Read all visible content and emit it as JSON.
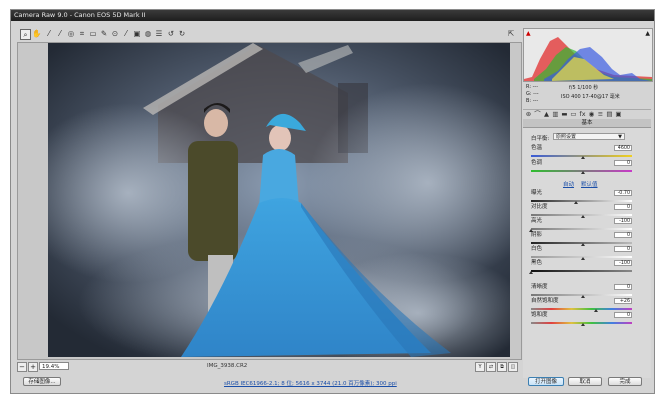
{
  "window": {
    "title": "Camera Raw 9.0 - Canon EOS 5D Mark II"
  },
  "toolbar": {
    "tools": [
      "zoom-tool",
      "hand-tool",
      "white-balance-tool",
      "color-sampler-tool",
      "target-adjustment-tool",
      "crop-tool",
      "straighten-tool",
      "spot-removal-tool",
      "red-eye-tool",
      "adjustment-brush-tool",
      "graduated-filter-tool",
      "radial-filter-tool",
      "preferences-tool",
      "rotate-left-tool",
      "rotate-right-tool"
    ],
    "fullscreen_icon": "fullscreen-icon"
  },
  "preview": {
    "zoom_value": "19.4%",
    "filename": "IMG_3938.CR2"
  },
  "camera_info": {
    "r": "R: ---",
    "g": "G: ---",
    "b": "B: ---",
    "aperture_shutter": "f/5  1/100 秒",
    "iso_lens": "ISO 400  17-40@17 毫米"
  },
  "panel": {
    "title": "基本",
    "white_balance_label": "白平衡:",
    "white_balance_value": "原照设置",
    "auto_label": "自动",
    "default_label": "默认值",
    "rows": [
      {
        "label": "色温",
        "value": "4600"
      },
      {
        "label": "色调",
        "value": "0"
      },
      {
        "label": "曝光",
        "value": "-0.70"
      },
      {
        "label": "对比度",
        "value": "0"
      },
      {
        "label": "高光",
        "value": "-100"
      },
      {
        "label": "阴影",
        "value": "0"
      },
      {
        "label": "白色",
        "value": "0"
      },
      {
        "label": "黑色",
        "value": "-100"
      },
      {
        "label": "清晰度",
        "value": "0"
      },
      {
        "label": "自然饱和度",
        "value": "+26"
      },
      {
        "label": "饱和度",
        "value": "0"
      }
    ]
  },
  "footer": {
    "save_button": "存储图像...",
    "workflow_link": "sRGB IEC61966-2.1; 8 位; 5616 x 3744 (21.0 百万像素); 300 ppi",
    "open_button": "打开图像",
    "cancel_button": "取消",
    "done_button": "完成"
  }
}
